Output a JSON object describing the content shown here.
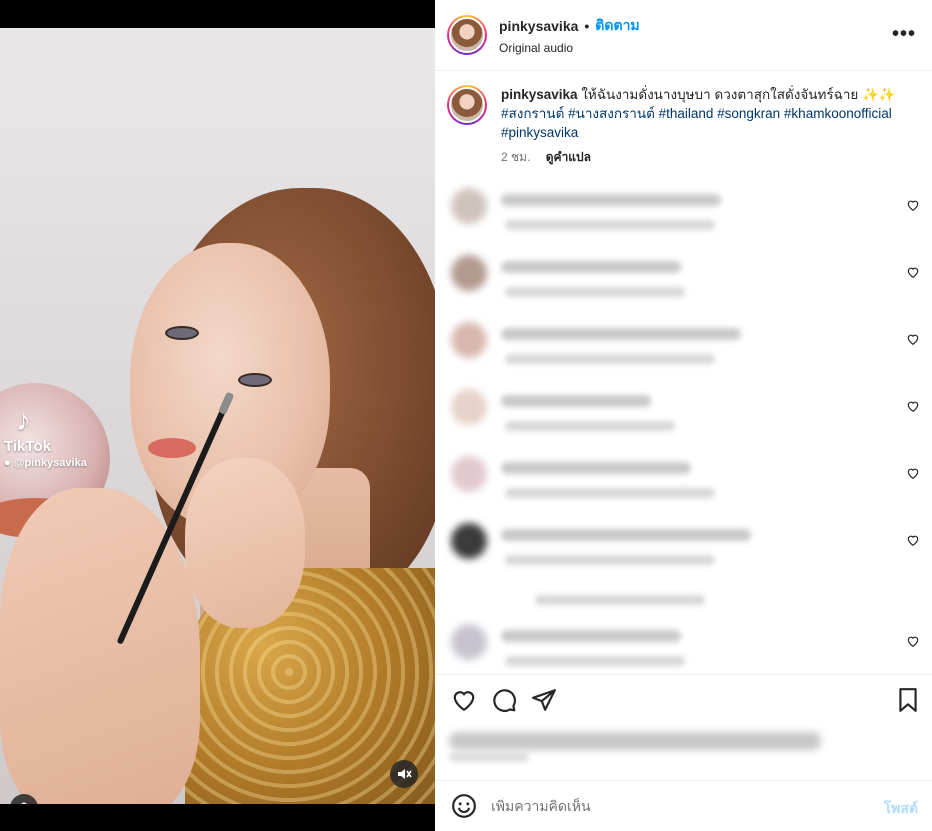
{
  "header": {
    "username": "pinkysavika",
    "separator": "•",
    "follow_label": "ติดตาม",
    "audio_label": "Original audio",
    "more_icon": "more-horizontal-icon"
  },
  "caption": {
    "username": "pinkysavika",
    "text": "ให้ฉันงามดั่งนางบุษบา ดวงตาสุกใสดั่งจันทร์ฉาย ✨✨",
    "hashtags_line1": "#สงกรานต์ #นางสงกรานต์ #thailand #songkran #khamkoonofficial",
    "hashtags_line2": "#pinkysavika",
    "time": "2 ชม.",
    "translate_label": "ดูคำแปล"
  },
  "video": {
    "watermark_name": "TikTok",
    "watermark_user": "@pinkysavika"
  },
  "comment_input": {
    "placeholder": "เพิ่มความคิดเห็น",
    "post_label": "โพสต์"
  },
  "colors": {
    "accent": "#0095f6",
    "hashtag": "#00376b",
    "post_disabled": "#b3dbff"
  }
}
